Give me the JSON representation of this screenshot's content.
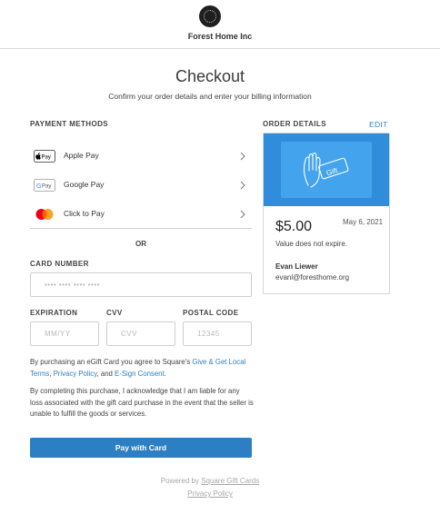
{
  "header": {
    "merchant_name": "Forest Home Inc"
  },
  "checkout": {
    "title": "Checkout",
    "subtitle": "Confirm your order details and enter your billing information"
  },
  "payment": {
    "section_title": "PAYMENT METHODS",
    "methods": [
      {
        "label": "Apple Pay",
        "icon": "apple-pay-icon",
        "icon_text": "Pay"
      },
      {
        "label": "Google Pay",
        "icon": "google-pay-icon",
        "icon_text": "Pay"
      },
      {
        "label": "Click to Pay",
        "icon": "click-to-pay-icon"
      }
    ],
    "or_label": "OR"
  },
  "card_form": {
    "card_number_label": "CARD NUMBER",
    "card_number_placeholder": "•••• •••• •••• ••••",
    "expiration_label": "EXPIRATION",
    "expiration_placeholder": "MM/YY",
    "cvv_label": "CVV",
    "cvv_placeholder": "CVV",
    "postal_label": "POSTAL CODE",
    "postal_placeholder": "12345"
  },
  "legal": {
    "p1_prefix": "By purchasing an eGift Card you agree to Square's ",
    "p1_link1": "Give & Get Local Terms",
    "p1_sep": ", ",
    "p1_link2": "Privacy Policy",
    "p1_mid": ", and ",
    "p1_link3": "E-Sign Consent",
    "p1_end": ".",
    "p2": "By completing this purchase, I acknowledge that I am liable for any loss associated with the gift card purchase in the event that the seller is unable to fulfill the goods or services."
  },
  "pay_button": "Pay with Card",
  "footer": {
    "powered_prefix": "Powered by ",
    "powered_link": "Square Gift Cards",
    "privacy": "Privacy Policy"
  },
  "order": {
    "section_title": "ORDER DETAILS",
    "edit_label": "EDIT",
    "gift_label": "Gift",
    "amount": "$5.00",
    "date": "May 6, 2021",
    "expiry_note": "Value does not expire.",
    "recipient_name": "Evan Liewer",
    "recipient_email": "evanl@foresthome.org"
  },
  "colors": {
    "accent": "#2b7fc2",
    "link": "#2d7fc4",
    "card_blue": "#2f8ddb",
    "card_inner": "#43a3ec"
  }
}
